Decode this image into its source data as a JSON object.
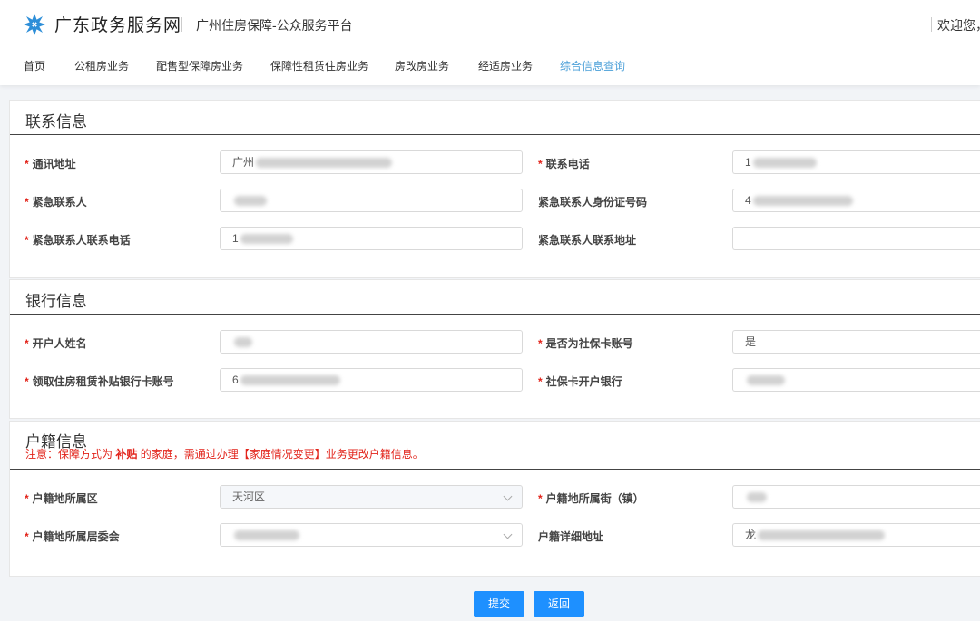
{
  "header": {
    "brand": "广东政务服务网",
    "platform": "广州住房保障-公众服务平台",
    "welcome": "欢迎您，"
  },
  "nav": [
    "首页",
    "公租房业务",
    "配售型保障房业务",
    "保障性租赁住房业务",
    "房改房业务",
    "经适房业务",
    "综合信息查询"
  ],
  "contact": {
    "title": "联系信息",
    "address_label": "通讯地址",
    "address_value": "广州",
    "phone_label": "联系电话",
    "phone_value": "1",
    "emergency_name_label": "紧急联系人",
    "emergency_id_label": "紧急联系人身份证号码",
    "emergency_id_value": "4",
    "emergency_phone_label": "紧急联系人联系电话",
    "emergency_phone_value": "1",
    "emergency_address_label": "紧急联系人联系地址"
  },
  "bank": {
    "title": "银行信息",
    "holder_label": "开户人姓名",
    "social_label": "是否为社保卡账号",
    "social_value": "是",
    "card_label": "领取住房租赁补贴银行卡账号",
    "card_value": "6",
    "social_bank_label": "社保卡开户银行"
  },
  "household": {
    "title": "户籍信息",
    "note_prefix": "注意：保障方式为",
    "note_bold": "补贴",
    "note_suffix": "的家庭，需通过办理【家庭情况变更】业务更改户籍信息。",
    "district_label": "户籍地所属区",
    "district_value": "天河区",
    "street_label": "户籍地所属街（镇）",
    "committee_label": "户籍地所属居委会",
    "detail_label": "户籍详细地址",
    "detail_value": "龙"
  },
  "buttons": {
    "submit": "提交",
    "back": "返回"
  },
  "colors": {
    "accent": "#1e90ff",
    "nav_active": "#4a9fd8",
    "required": "#e2231a"
  }
}
